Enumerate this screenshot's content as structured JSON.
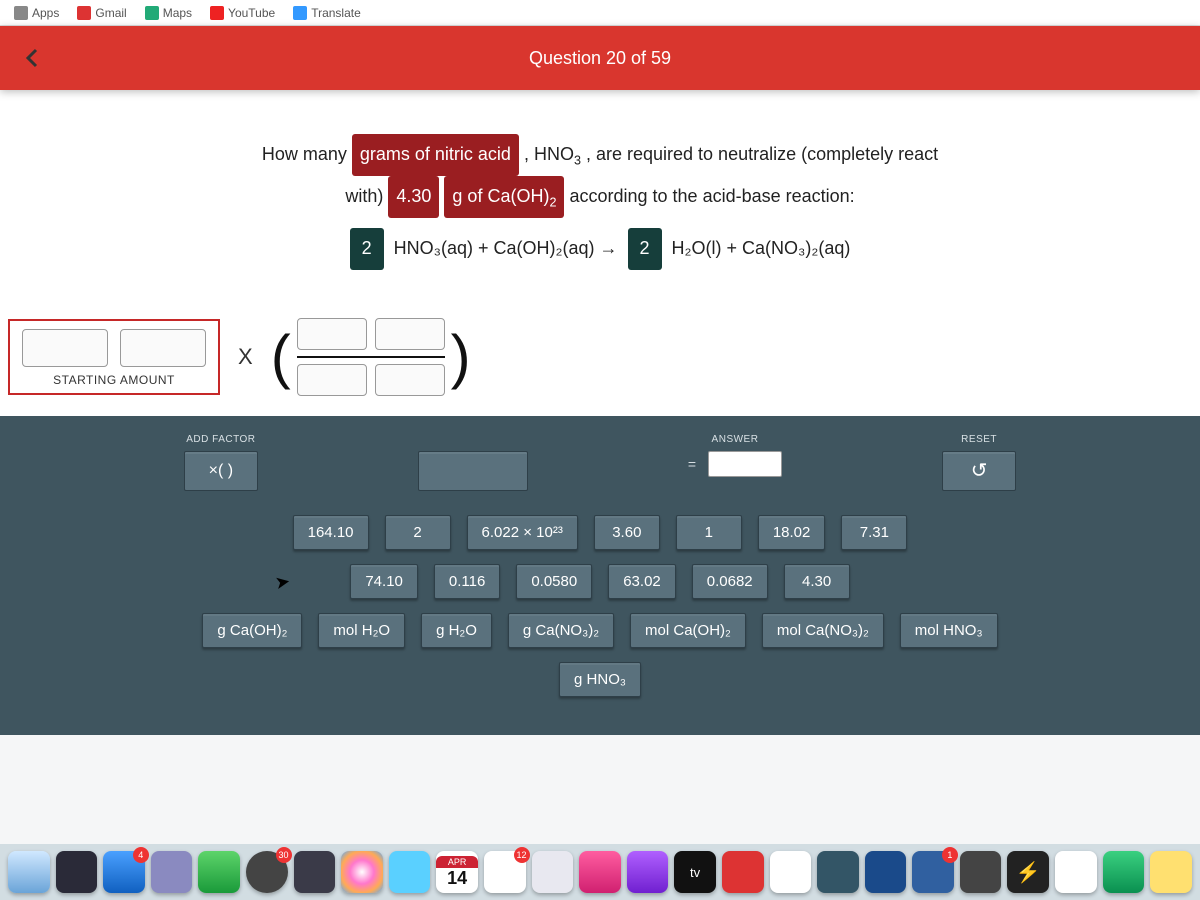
{
  "bookmarks": [
    "Apps",
    "Gmail",
    "Maps",
    "YouTube",
    "Translate"
  ],
  "header": {
    "question_counter": "Question 20 of 59"
  },
  "question": {
    "line1_pre": "How many ",
    "chip1": "grams of nitric acid",
    "line1_mid": " , HNO",
    "line1_post": ", are required to neutralize (completely react",
    "line2_pre": "with) ",
    "chip2": "4.30",
    "chip3": "g of Ca(OH)",
    "line2_post": " according to the acid-base reaction:",
    "coef1": "2",
    "eq_mid": "HNO₃(aq) + Ca(OH)₂(aq) →",
    "coef2": "2",
    "eq_end": "H₂O(l) + Ca(NO₃)₂(aq)"
  },
  "work": {
    "starting_label": "STARTING AMOUNT",
    "times": "X"
  },
  "tools": {
    "add_factor": "ADD FACTOR",
    "add_factor_sym": "×(  )",
    "answer": "ANSWER",
    "eq": "=",
    "reset": "RESET",
    "reset_sym": "↺"
  },
  "tiles_row1": [
    "164.10",
    "2",
    "6.022 × 10²³",
    "3.60",
    "1",
    "18.02",
    "7.31"
  ],
  "tiles_row2": [
    "74.10",
    "0.116",
    "0.0580",
    "63.02",
    "0.0682",
    "4.30"
  ],
  "tiles_row3": [
    "g Ca(OH)₂",
    "mol H₂O",
    "g H₂O",
    "g Ca(NO₃)₂",
    "mol Ca(OH)₂",
    "mol Ca(NO₃)₂",
    "mol HNO₃"
  ],
  "tiles_row4": [
    "g HNO₃"
  ],
  "dock": {
    "cal_month": "APR",
    "cal_day": "14",
    "tv": "tv"
  }
}
